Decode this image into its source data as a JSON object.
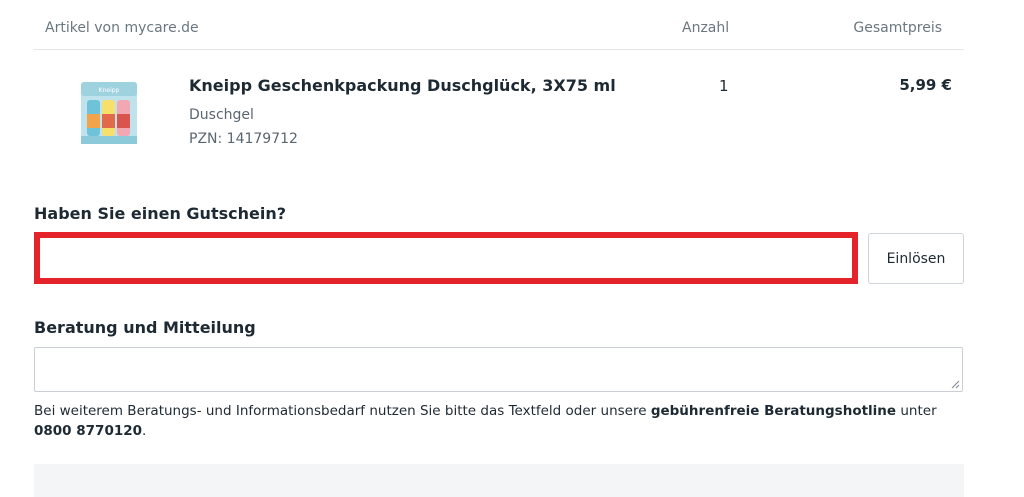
{
  "cart": {
    "header": {
      "article": "Artikel von mycare.de",
      "quantity": "Anzahl",
      "total": "Gesamtpreis"
    },
    "item": {
      "name": "Kneipp Geschenkpackung Duschglück, 3X75 ml",
      "type": "Duschgel",
      "pzn": "PZN: 14179712",
      "quantity": "1",
      "price": "5,99 €",
      "image_icon": "product-box-image"
    }
  },
  "coupon": {
    "heading": "Haben Sie einen Gutschein?",
    "input_value": "",
    "input_placeholder": "",
    "button_label": "Einlösen",
    "highlight_color": "#e5232b"
  },
  "advice": {
    "heading": "Beratung und Mitteilung",
    "textarea_value": "",
    "note_prefix": "Bei weiterem Beratungs- und Informationsbedarf nutzen Sie bitte das Textfeld oder unsere ",
    "note_bold_1": "gebührenfreie Beratungshotline",
    "note_middle": " unter ",
    "note_bold_2": "0800 8770120",
    "note_suffix": "."
  }
}
